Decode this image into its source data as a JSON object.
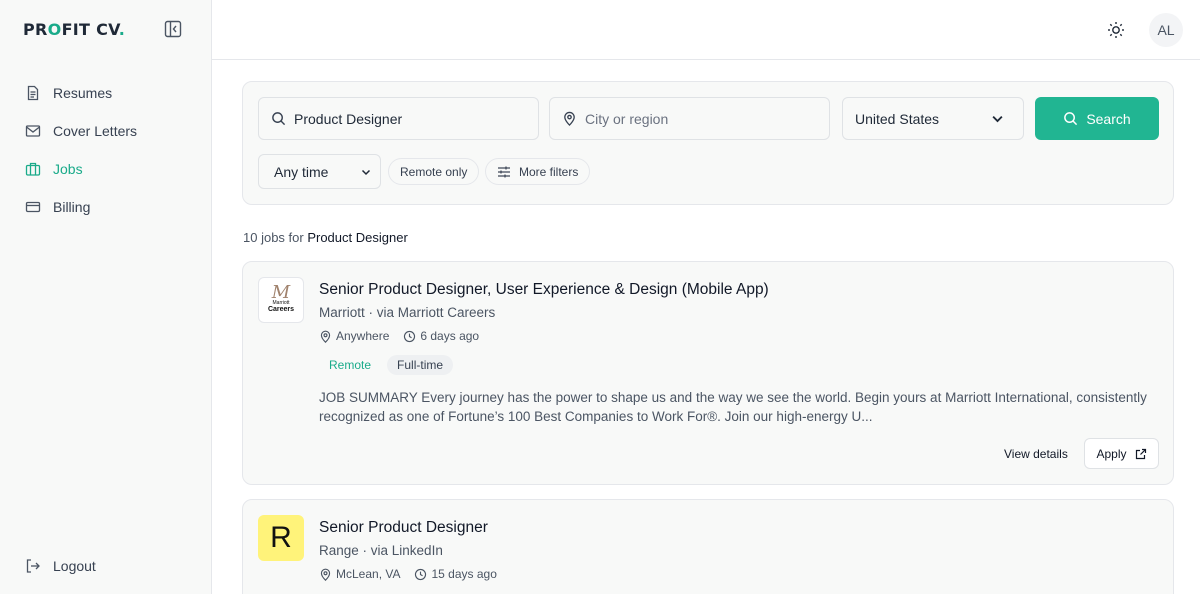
{
  "brand": {
    "name_parts": [
      "PR",
      "O",
      "FIT CV",
      "."
    ],
    "accent": "#1aab8a"
  },
  "sidebar": {
    "items": [
      {
        "label": "Resumes",
        "icon": "document-icon"
      },
      {
        "label": "Cover Letters",
        "icon": "mail-icon"
      },
      {
        "label": "Jobs",
        "icon": "briefcase-icon",
        "active": true
      },
      {
        "label": "Billing",
        "icon": "credit-card-icon"
      }
    ],
    "logout_label": "Logout"
  },
  "header": {
    "avatar_initials": "AL",
    "theme_icon": "sun-icon"
  },
  "search": {
    "query_value": "Product Designer",
    "city_placeholder": "City or region",
    "country_value": "United States",
    "search_label": "Search",
    "time_value": "Any time",
    "remote_only_label": "Remote only",
    "more_filters_label": "More filters"
  },
  "results": {
    "count_prefix": "10 jobs for",
    "query": "Product Designer"
  },
  "jobs": [
    {
      "title": "Senior Product Designer, User Experience & Design (Mobile App)",
      "company_line": "Marriott · via Marriott Careers",
      "location": "Anywhere",
      "posted": "6 days ago",
      "tags": [
        "Remote",
        "Full-time"
      ],
      "description": "JOB SUMMARY Every journey has the power to shape us and the way we see the world. Begin yours at Marriott International, consistently recognized as one of Fortune’s 100 Best Companies to Work For®. Join our high-energy U...",
      "view_details_label": "View details",
      "apply_label": "Apply",
      "logo": {
        "line1": "Marriott",
        "line2": "Careers"
      }
    },
    {
      "title": "Senior Product Designer",
      "company_line": "Range · via LinkedIn",
      "location": "McLean, VA",
      "posted": "15 days ago",
      "logo": {
        "letter": "R",
        "color": "#fff37a"
      }
    }
  ]
}
